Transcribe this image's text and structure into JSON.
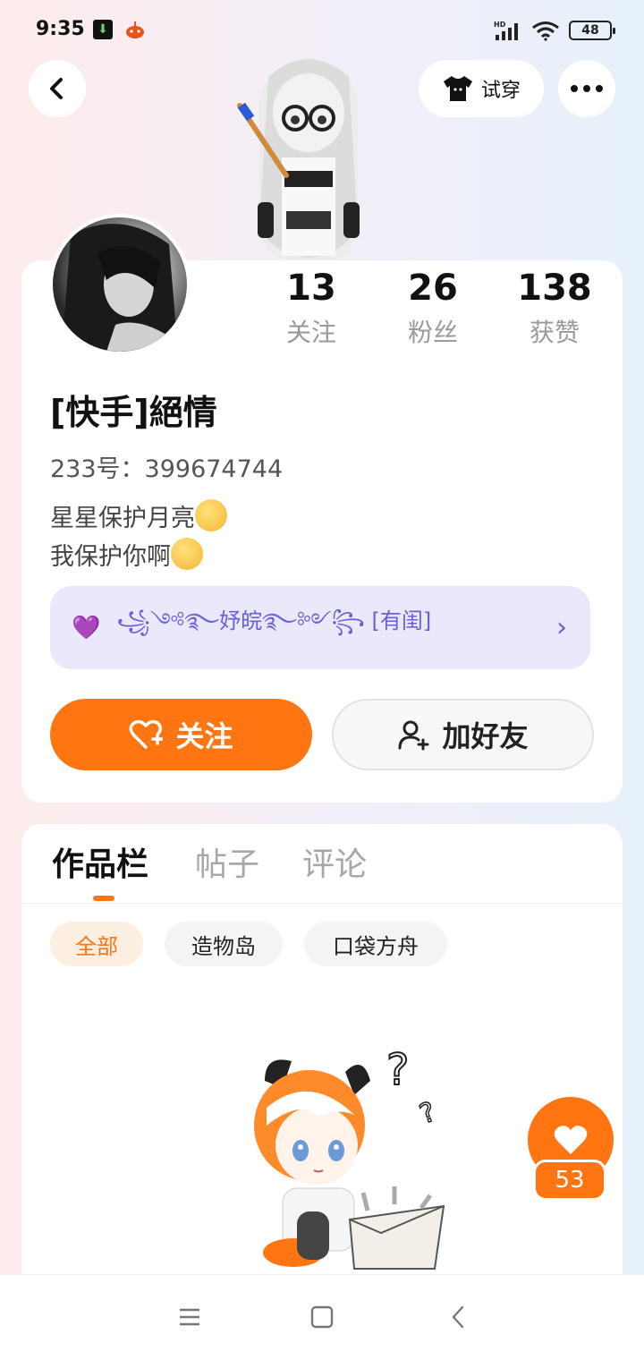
{
  "status_bar": {
    "time": "9:35",
    "network": "HD",
    "battery": "48",
    "icons": [
      "download-app-icon",
      "app-notification-icon",
      "signal-icon",
      "wifi-icon",
      "battery-icon"
    ]
  },
  "header": {
    "back_icon": "back-icon",
    "try_on_label": "试穿",
    "try_on_icon": "tshirt-icon",
    "more_icon": "more-icon"
  },
  "profile": {
    "stats": [
      {
        "value": "13",
        "label": "关注"
      },
      {
        "value": "26",
        "label": "粉丝"
      },
      {
        "value": "138",
        "label": "获赞"
      }
    ],
    "username": "[快手]絕情",
    "uid": "233号：399674744",
    "bio_line1": "星星保护月亮",
    "bio_line2": "我保护你啊",
    "banner_text": "꧁༺࿐妤皖࿐༻꧂ [有闺]",
    "follow_label": "关注",
    "add_friend_label": "加好友"
  },
  "works": {
    "tabs": [
      {
        "label": "作品栏",
        "active": true
      },
      {
        "label": "帖子",
        "active": false
      },
      {
        "label": "评论",
        "active": false
      }
    ],
    "filters": [
      {
        "label": "全部",
        "active": true
      },
      {
        "label": "造物岛",
        "active": false
      },
      {
        "label": "口袋方舟",
        "active": false
      }
    ]
  },
  "like_fab": {
    "count": "53",
    "icon": "heart-icon"
  },
  "colors": {
    "accent": "#ff7511",
    "banner_bg": "#e9e9fb",
    "banner_text": "#6d5fd8"
  },
  "nav": {
    "icons": [
      "menu-icon",
      "home-icon",
      "back-nav-icon"
    ]
  }
}
